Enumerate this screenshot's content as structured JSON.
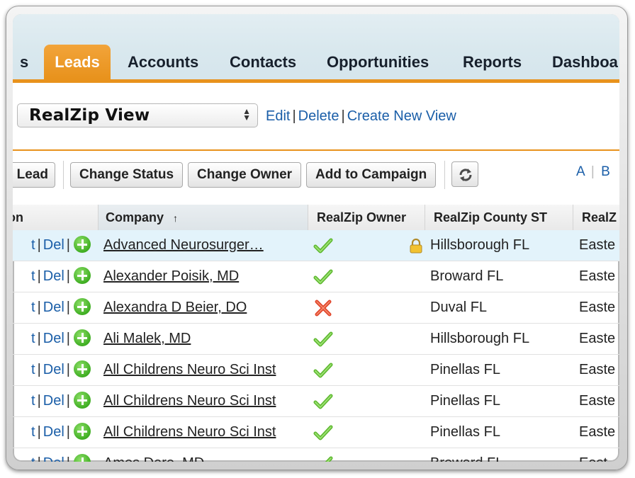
{
  "tabs": [
    {
      "label": "s",
      "active": false
    },
    {
      "label": "Leads",
      "active": true
    },
    {
      "label": "Accounts",
      "active": false
    },
    {
      "label": "Contacts",
      "active": false
    },
    {
      "label": "Opportunities",
      "active": false
    },
    {
      "label": "Reports",
      "active": false
    },
    {
      "label": "Dashboa",
      "active": false
    }
  ],
  "view": {
    "selected": "RealZip View",
    "edit": "Edit",
    "delete": "Delete",
    "create": "Create New View",
    "separator": "|"
  },
  "buttons": {
    "lead": "Lead",
    "change_status": "Change Status",
    "change_owner": "Change Owner",
    "add_campaign": "Add to Campaign",
    "refresh_icon": "refresh-icon"
  },
  "alpha": {
    "a": "A",
    "sep": "|",
    "b": "B"
  },
  "columns": {
    "action": "tion",
    "company": "Company",
    "sort_arrow": "↑",
    "owner": "RealZip Owner",
    "county": "RealZip County ST",
    "realz": "RealZ"
  },
  "row_links": {
    "edit_fragment": "t",
    "sep": "|",
    "del": "Del"
  },
  "rows": [
    {
      "company": "Advanced Neurosurger…",
      "owner": "check",
      "locked": true,
      "county": "Hillsborough FL",
      "realz": "Easte"
    },
    {
      "company": "Alexander Poisik, MD",
      "owner": "check",
      "locked": false,
      "county": "Broward FL",
      "realz": "Easte"
    },
    {
      "company": "Alexandra D Beier, DO",
      "owner": "cross",
      "locked": false,
      "county": "Duval FL",
      "realz": "Easte"
    },
    {
      "company": "Ali Malek, MD",
      "owner": "check",
      "locked": false,
      "county": "Hillsborough FL",
      "realz": "Easte"
    },
    {
      "company": "All Childrens Neuro Sci Inst",
      "owner": "check",
      "locked": false,
      "county": "Pinellas FL",
      "realz": "Easte"
    },
    {
      "company": "All Childrens Neuro Sci Inst",
      "owner": "check",
      "locked": false,
      "county": "Pinellas FL",
      "realz": "Easte"
    },
    {
      "company": "All Childrens Neuro Sci Inst",
      "owner": "check",
      "locked": false,
      "county": "Pinellas FL",
      "realz": "Easte"
    },
    {
      "company": "Amos Dare, MD",
      "owner": "check",
      "locked": false,
      "county": "Broward FL",
      "realz": "East"
    }
  ],
  "colors": {
    "accent": "#e8921c",
    "link": "#1a5ea8",
    "highlight_row": "#e3f3fb"
  }
}
